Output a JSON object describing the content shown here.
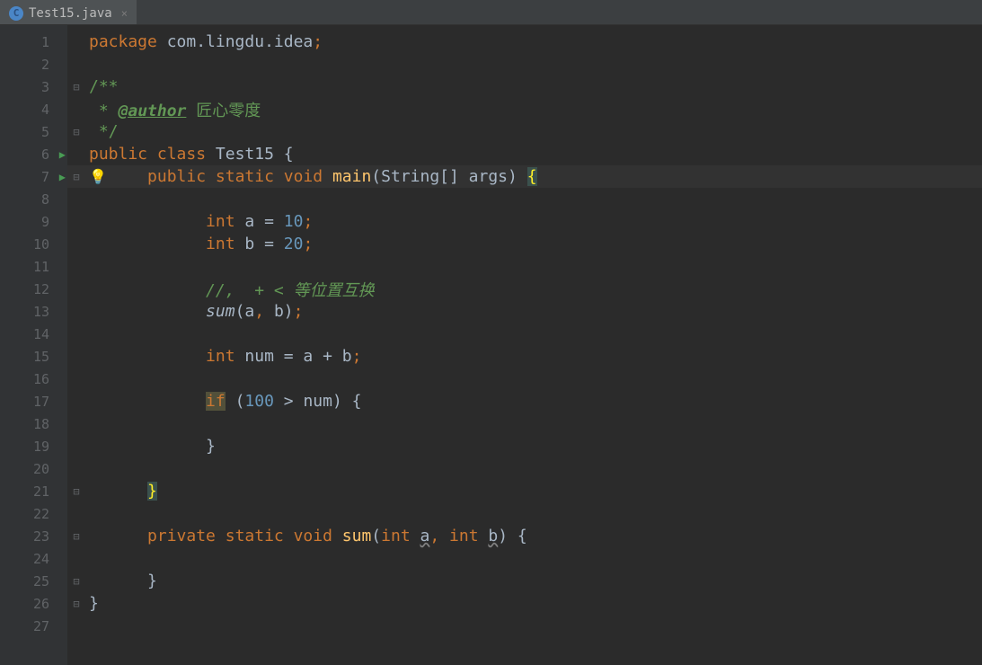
{
  "tab": {
    "icon": "C",
    "name": "Test15.java",
    "close": "×"
  },
  "lines": [
    {
      "n": 1,
      "fold": "",
      "run": false,
      "tokens": [
        {
          "t": "kw",
          "v": "package "
        },
        {
          "t": "pkg",
          "v": "com.lingdu.idea"
        },
        {
          "t": "comma-orange",
          "v": ";"
        }
      ],
      "indent": 0
    },
    {
      "n": 2,
      "fold": "",
      "run": false,
      "tokens": [],
      "indent": 0
    },
    {
      "n": 3,
      "fold": "⊟",
      "run": false,
      "tokens": [
        {
          "t": "doc-comment",
          "v": "/**"
        }
      ],
      "indent": 0
    },
    {
      "n": 4,
      "fold": "",
      "run": false,
      "tokens": [
        {
          "t": "doc-comment",
          "v": " * "
        },
        {
          "t": "doc-tag",
          "v": "@author"
        },
        {
          "t": "doc-author",
          "v": " 匠心零度"
        }
      ],
      "indent": 0
    },
    {
      "n": 5,
      "fold": "⊟",
      "run": false,
      "tokens": [
        {
          "t": "doc-comment",
          "v": " */"
        }
      ],
      "indent": 0
    },
    {
      "n": 6,
      "fold": "",
      "run": true,
      "tokens": [
        {
          "t": "kw",
          "v": "public class "
        },
        {
          "t": "class-name",
          "v": "Test15 "
        },
        {
          "t": "punct",
          "v": "{"
        }
      ],
      "indent": 0
    },
    {
      "n": 7,
      "fold": "⊟",
      "run": true,
      "bulb": true,
      "current": true,
      "tokens": [
        {
          "t": "kw",
          "v": "public static "
        },
        {
          "t": "kw",
          "v": "void "
        },
        {
          "t": "method-name",
          "v": "main"
        },
        {
          "t": "punct",
          "v": "(String[] args) "
        },
        {
          "t": "highlight-brace",
          "v": "{"
        }
      ],
      "indent": 2
    },
    {
      "n": 8,
      "fold": "",
      "run": false,
      "tokens": [],
      "indent": 0
    },
    {
      "n": 9,
      "fold": "",
      "run": false,
      "tokens": [
        {
          "t": "kw",
          "v": "int "
        },
        {
          "t": "pkg",
          "v": "a = "
        },
        {
          "t": "num",
          "v": "10"
        },
        {
          "t": "comma-orange",
          "v": ";"
        }
      ],
      "indent": 4
    },
    {
      "n": 10,
      "fold": "",
      "run": false,
      "tokens": [
        {
          "t": "kw",
          "v": "int "
        },
        {
          "t": "pkg",
          "v": "b = "
        },
        {
          "t": "num",
          "v": "20"
        },
        {
          "t": "comma-orange",
          "v": ";"
        }
      ],
      "indent": 4
    },
    {
      "n": 11,
      "fold": "",
      "run": false,
      "tokens": [],
      "indent": 0
    },
    {
      "n": 12,
      "fold": "",
      "run": false,
      "tokens": [
        {
          "t": "comment",
          "v": "//,  + < 等位置互换"
        }
      ],
      "indent": 4
    },
    {
      "n": 13,
      "fold": "",
      "run": false,
      "tokens": [
        {
          "t": "italic-call",
          "v": "sum"
        },
        {
          "t": "punct",
          "v": "(a"
        },
        {
          "t": "comma-orange",
          "v": ", "
        },
        {
          "t": "punct",
          "v": "b)"
        },
        {
          "t": "comma-orange",
          "v": ";"
        }
      ],
      "indent": 4
    },
    {
      "n": 14,
      "fold": "",
      "run": false,
      "tokens": [],
      "indent": 0
    },
    {
      "n": 15,
      "fold": "",
      "run": false,
      "tokens": [
        {
          "t": "kw",
          "v": "int "
        },
        {
          "t": "pkg",
          "v": "num = a + b"
        },
        {
          "t": "comma-orange",
          "v": ";"
        }
      ],
      "indent": 4
    },
    {
      "n": 16,
      "fold": "",
      "run": false,
      "tokens": [],
      "indent": 0
    },
    {
      "n": 17,
      "fold": "",
      "run": false,
      "tokens": [
        {
          "t": "highlight-if",
          "v": "if"
        },
        {
          "t": "punct",
          "v": " ("
        },
        {
          "t": "num",
          "v": "100"
        },
        {
          "t": "punct",
          "v": " > num) {"
        }
      ],
      "indent": 4
    },
    {
      "n": 18,
      "fold": "",
      "run": false,
      "tokens": [],
      "indent": 0
    },
    {
      "n": 19,
      "fold": "",
      "run": false,
      "tokens": [
        {
          "t": "punct",
          "v": "}"
        }
      ],
      "indent": 4
    },
    {
      "n": 20,
      "fold": "",
      "run": false,
      "tokens": [],
      "indent": 0
    },
    {
      "n": 21,
      "fold": "⊟",
      "run": false,
      "tokens": [
        {
          "t": "highlight-brace",
          "v": "}"
        }
      ],
      "indent": 2
    },
    {
      "n": 22,
      "fold": "",
      "run": false,
      "tokens": [],
      "indent": 0
    },
    {
      "n": 23,
      "fold": "⊟",
      "run": false,
      "tokens": [
        {
          "t": "kw",
          "v": "private static "
        },
        {
          "t": "kw",
          "v": "void "
        },
        {
          "t": "method-name",
          "v": "sum"
        },
        {
          "t": "punct",
          "v": "("
        },
        {
          "t": "kw",
          "v": "int "
        },
        {
          "t": "underline-param",
          "v": "a"
        },
        {
          "t": "comma-orange",
          "v": ", "
        },
        {
          "t": "kw",
          "v": "int "
        },
        {
          "t": "underline-param",
          "v": "b"
        },
        {
          "t": "punct",
          "v": ") {"
        }
      ],
      "indent": 2
    },
    {
      "n": 24,
      "fold": "",
      "run": false,
      "tokens": [],
      "indent": 0
    },
    {
      "n": 25,
      "fold": "⊟",
      "run": false,
      "tokens": [
        {
          "t": "punct",
          "v": "}"
        }
      ],
      "indent": 2
    },
    {
      "n": 26,
      "fold": "⊟",
      "run": false,
      "tokens": [
        {
          "t": "punct",
          "v": "}"
        }
      ],
      "indent": 0
    },
    {
      "n": 27,
      "fold": "",
      "run": false,
      "tokens": [],
      "indent": 0
    }
  ]
}
